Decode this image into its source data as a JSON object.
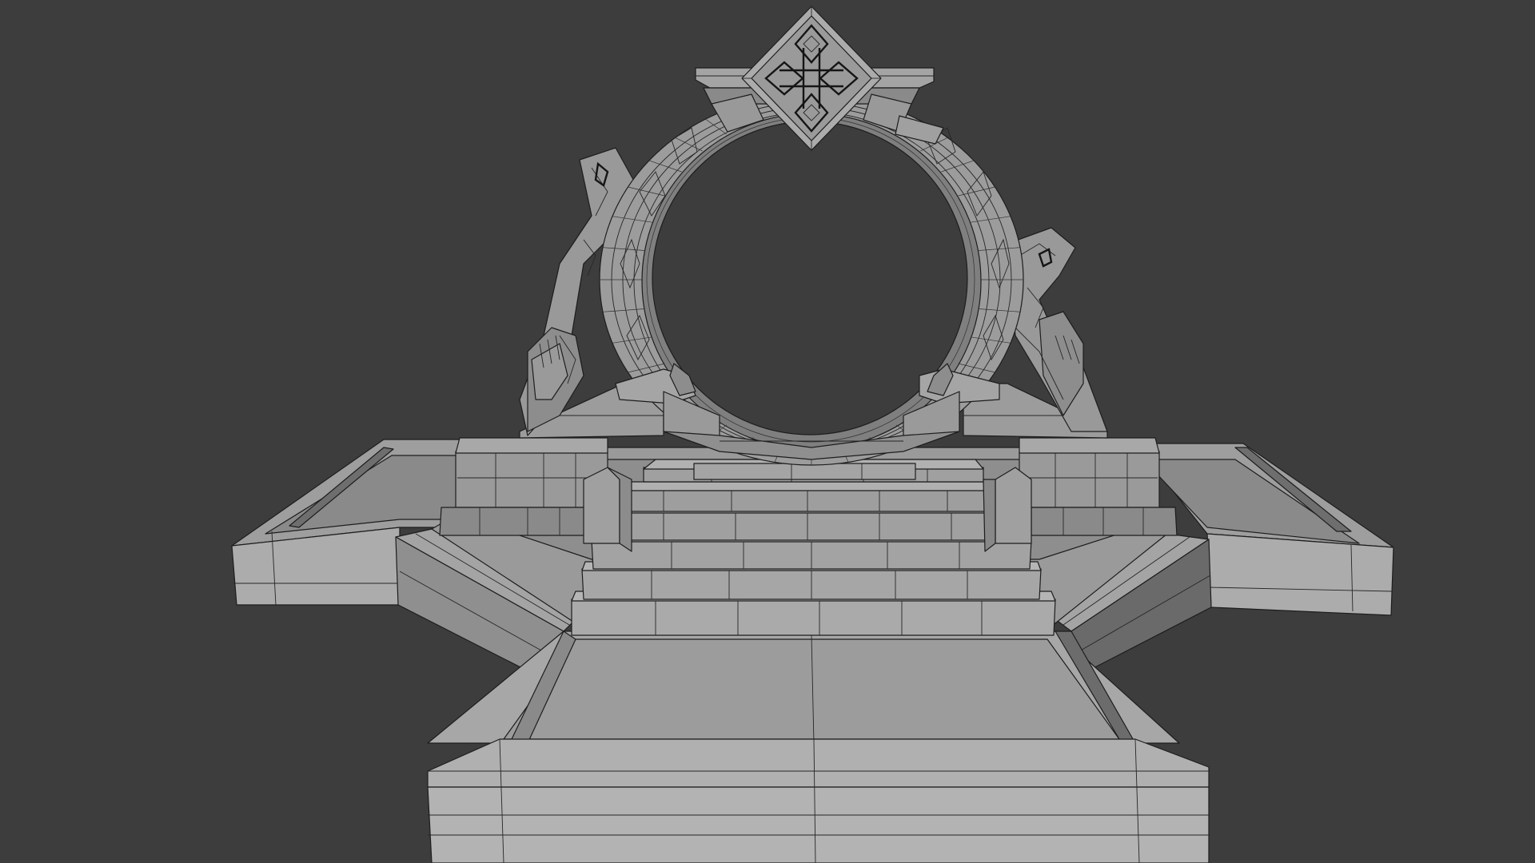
{
  "viewport": {
    "background_color": "#3d3d3d",
    "mode": "solid-shading-wireframe-overlay"
  },
  "scene": {
    "object": "stone-portal-platform",
    "colors": {
      "top_face": "#a4a4a4",
      "side_face": "#8c8c8c",
      "dark_face": "#6a6a6a",
      "ring_face": "#9a9a9a",
      "inner_ring": "#7c7c7c",
      "wire": "#262626"
    },
    "icons": [
      "celtic-knot-emblem-icon"
    ]
  }
}
